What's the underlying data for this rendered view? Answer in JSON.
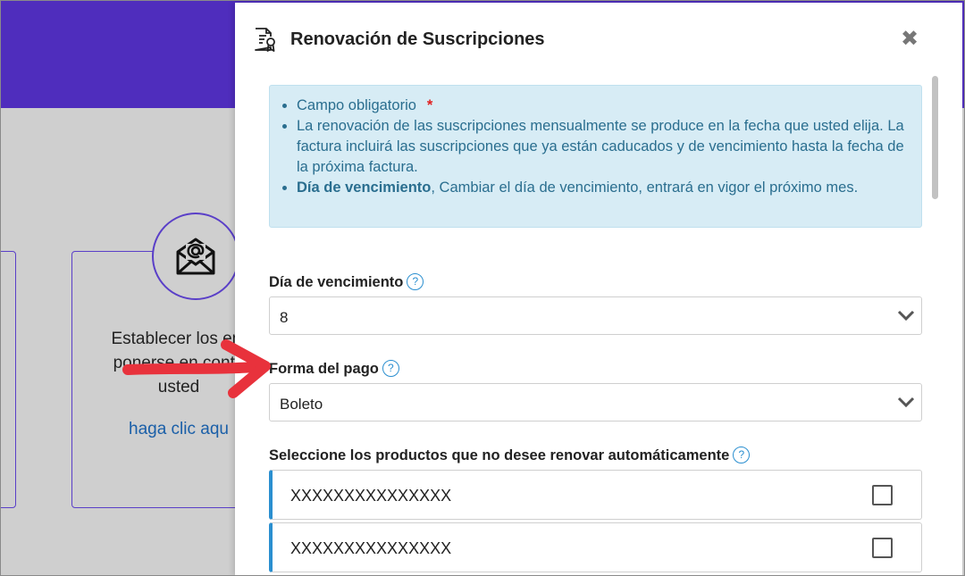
{
  "background": {
    "card_text_lines": [
      "Establecer los em",
      "ponerse en conta",
      "usted"
    ],
    "card_link": "haga clic aqu"
  },
  "modal": {
    "title": "Renovación de Suscripciones",
    "close_glyph": "✖",
    "info": {
      "item1": "Campo obligatorio",
      "required_mark": "*",
      "item2": "La renovación de las suscripciones mensualmente se produce en la fecha que usted elija. La factura incluirá las suscripciones que ya están caducados y de vencimiento hasta la fecha de la próxima factura.",
      "item3_bold": "Día de vencimiento",
      "item3_rest": ", Cambiar el día de vencimiento, entrará en vigor el próximo mes."
    },
    "due_day": {
      "label": "Día de vencimiento",
      "value": "8",
      "help": "?"
    },
    "payment": {
      "label": "Forma del pago",
      "value": "Boleto",
      "help": "?"
    },
    "products": {
      "label": "Seleccione los productos que no desee renovar automáticamente",
      "help": "?",
      "items": [
        {
          "name": "XXXXXXXXXXXXXXX",
          "checked": false
        },
        {
          "name": "XXXXXXXXXXXXXXX",
          "checked": false
        }
      ]
    }
  },
  "colors": {
    "header_purple": "#4f2dbd",
    "info_bg": "#d7ecf5",
    "info_text": "#2a6e8f",
    "accent_blue": "#2b8fd0",
    "annotation_arrow": "#e8323c"
  },
  "icons": [
    "envelope-at-icon",
    "certificate-document-icon",
    "close-icon",
    "help-icon",
    "chevron-down-icon",
    "annotation-arrow"
  ]
}
